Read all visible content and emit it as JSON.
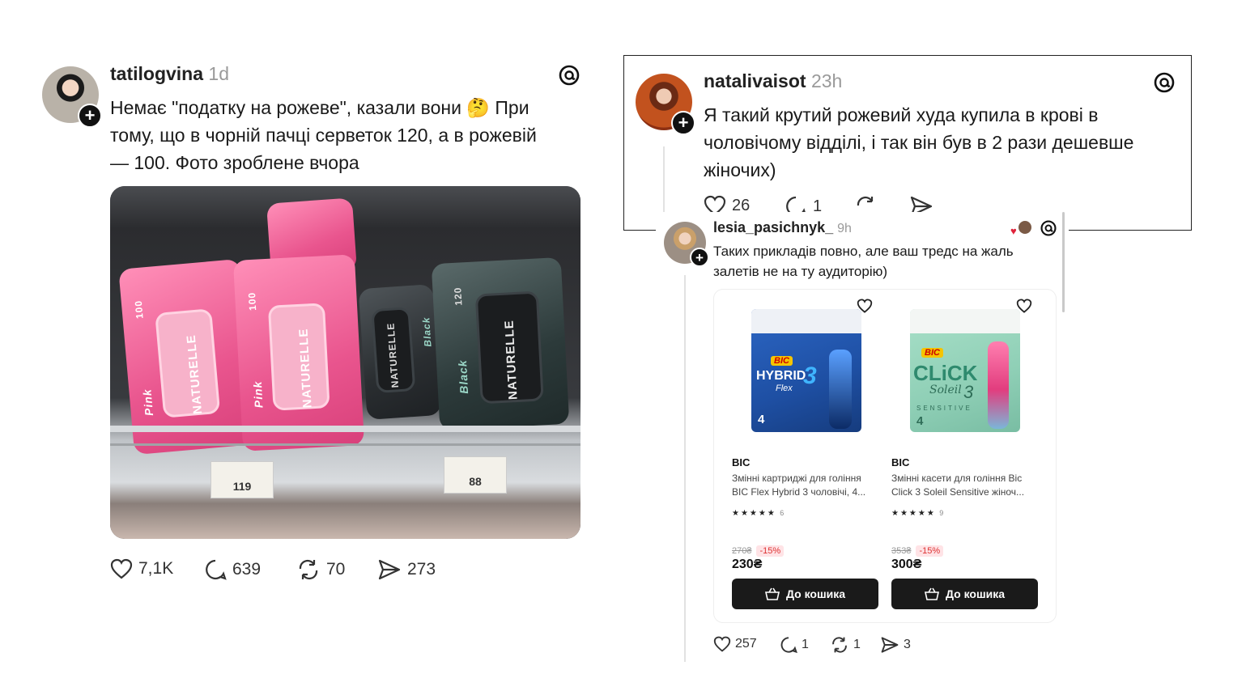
{
  "post1": {
    "username": "tatilogvina",
    "time": "1d",
    "text_line1": "Немає \"податку на рожеве\", казали вони 🤔 При",
    "text_line2": "тому, що в чорній пачці серветок 120, а в рожевій",
    "text_line3": "— 100. Фото зроблене вчора",
    "photo_labels": {
      "brand": "NATURELLE",
      "pink_name": "Pink",
      "black_name": "Black",
      "pink_count": "100",
      "black_count": "120",
      "price_left": "119",
      "price_right": "88"
    },
    "likes": "7,1K",
    "comments": "639",
    "reposts": "70",
    "shares": "273"
  },
  "post2": {
    "username": "natalivaisot",
    "time": "23h",
    "text_line1": "Я такий крутий рожевий худа купила в крові в",
    "text_line2": "чоловічому відділі, і так він був в 2 рази дешевше",
    "text_line3": "жіночих)",
    "likes": "26",
    "comments": "1"
  },
  "post3": {
    "username": "lesia_pasichnyk_",
    "time": "9h",
    "text_line1": "Таких прикладів повно, але ваш тредс на жаль",
    "text_line2": "залетів не на ту аудиторію)",
    "products": [
      {
        "pack_brand": "BIC",
        "pack_name": "HYBRID",
        "pack_sub": "Flex",
        "pack_num": "3",
        "pack_count": "4",
        "brand": "BIC",
        "title_line1": "Змінні картриджі для гоління",
        "title_line2": "BIC Flex Hybrid 3 чоловічі, 4...",
        "stars": "★★★★★",
        "reviews": "6",
        "old_price": "270₴",
        "discount": "-15%",
        "price": "230₴",
        "cart_label": "До кошика"
      },
      {
        "pack_brand": "BIC",
        "pack_name": "CLiCK",
        "pack_sub": "Soleil",
        "pack_num": "3",
        "pack_extra": "SENSITIVE",
        "pack_count": "4",
        "brand": "BIC",
        "title_line1": "Змінні касети для гоління Bic",
        "title_line2": "Click 3 Soleil Sensitive жіноч...",
        "stars": "★★★★★",
        "reviews": "9",
        "old_price": "353₴",
        "discount": "-15%",
        "price": "300₴",
        "cart_label": "До кошика"
      }
    ],
    "likes": "257",
    "comments": "1",
    "reposts": "1",
    "shares": "3"
  },
  "colors": {
    "pink": "#e9558e",
    "dark": "#2a2e31",
    "bic_blue": "#1e4fa3",
    "bic_mint": "#8fcfb6",
    "discount_red": "#d33333"
  }
}
